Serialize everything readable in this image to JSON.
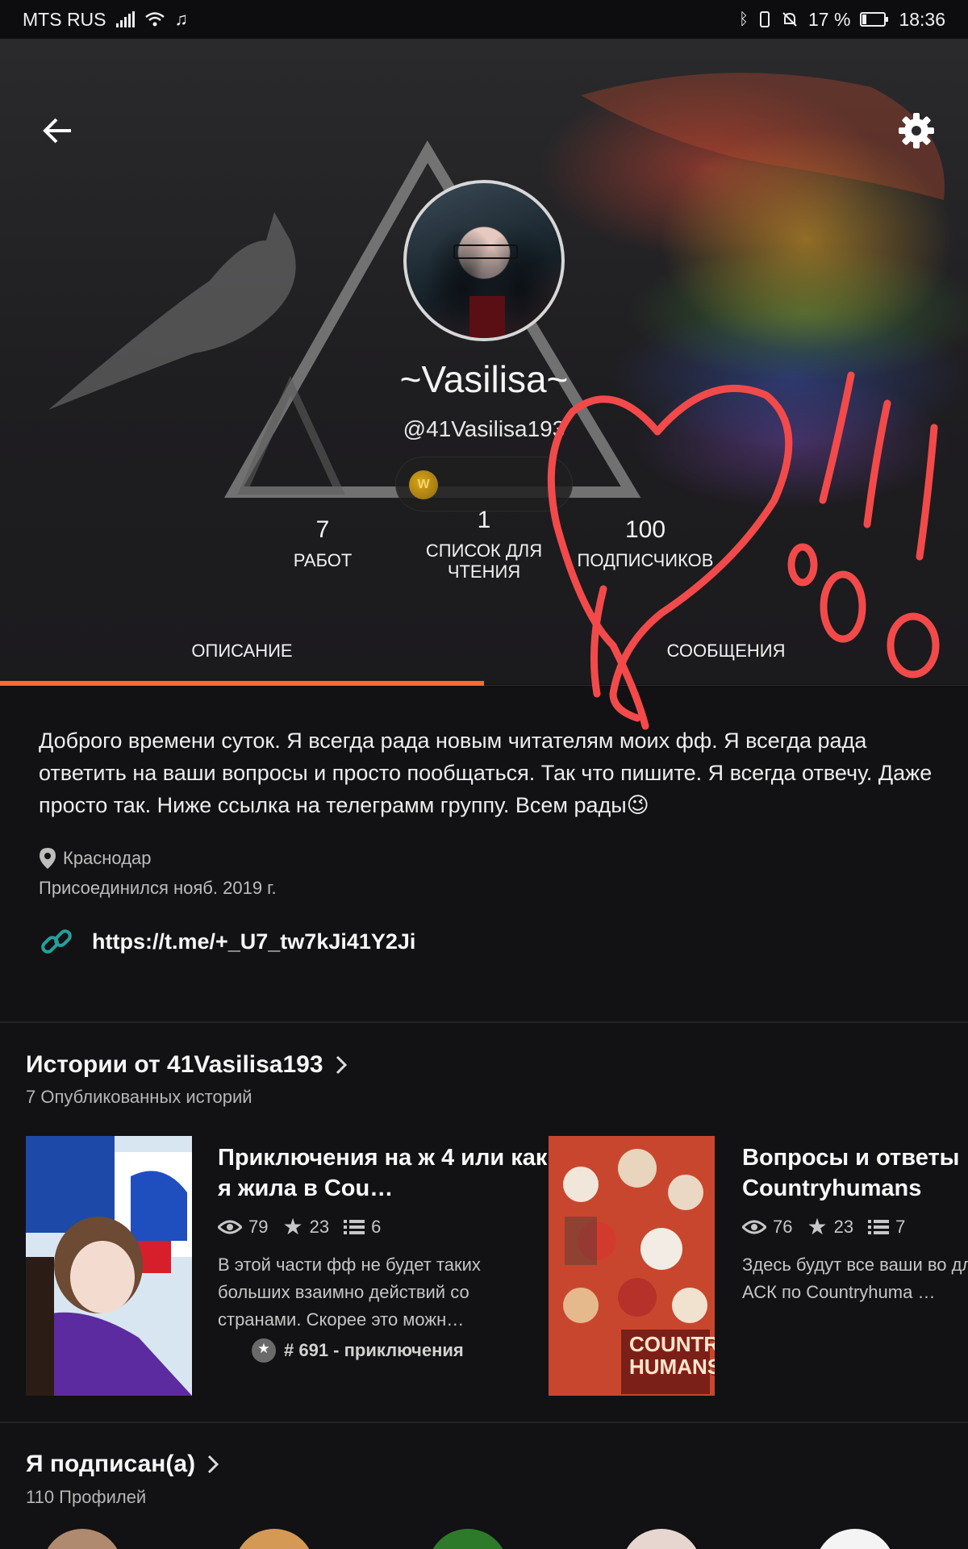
{
  "status_bar": {
    "carrier": "MTS RUS",
    "battery": "17 %",
    "time": "18:36"
  },
  "profile": {
    "display_name": "~Vasilisa~",
    "username": "@41Vasilisa193",
    "coin_label": "W",
    "stats": [
      {
        "value": "7",
        "label": "РАБОТ"
      },
      {
        "value": "1",
        "label": "СПИСОК ДЛЯ ЧТЕНИЯ"
      },
      {
        "value": "100",
        "label": "ПОДПИСЧИКОВ"
      }
    ]
  },
  "tabs": [
    {
      "label": "ОПИСАНИЕ",
      "active": true
    },
    {
      "label": "СООБЩЕНИЯ",
      "active": false
    }
  ],
  "about": {
    "text": "Доброго времени суток. Я всегда рада новым читателям моих фф. Я всегда рада ответить на ваши вопросы и просто пообщаться. Так что пишите. Я всегда отвечу. Даже просто так. Ниже ссылка на телеграмм группу. Всем рады😉",
    "location": "Краснодар",
    "joined": "Присоединился нояб. 2019 г.",
    "link": "https://t.me/+_U7_tw7kJi41Y2Ji"
  },
  "stories_section": {
    "title": "Истории от 41Vasilisa193",
    "subtitle": "7 Опубликованных историй",
    "items": [
      {
        "title": "Приключения на  ж 4 или как я жила в Cou…",
        "reads": "79",
        "votes": "23",
        "parts": "6",
        "description": "В этой части фф не будет таких больших взаимно действий со странами. Скорее это можн…",
        "rank": "# 691 - приключения"
      },
      {
        "title": "Вопросы и ответы Countryhumans",
        "reads": "76",
        "votes": "23",
        "parts": "7",
        "description": "Здесь будут все ваши во для АСК по Countryhuma …",
        "cover_text": "COUNTRY HUMANS"
      }
    ]
  },
  "following_section": {
    "title": "Я подписан(а)",
    "subtitle": "110 Профилей"
  },
  "colors": {
    "accent": "#ff6b2e",
    "background": "#121114",
    "annotation": "#f24a4a"
  }
}
